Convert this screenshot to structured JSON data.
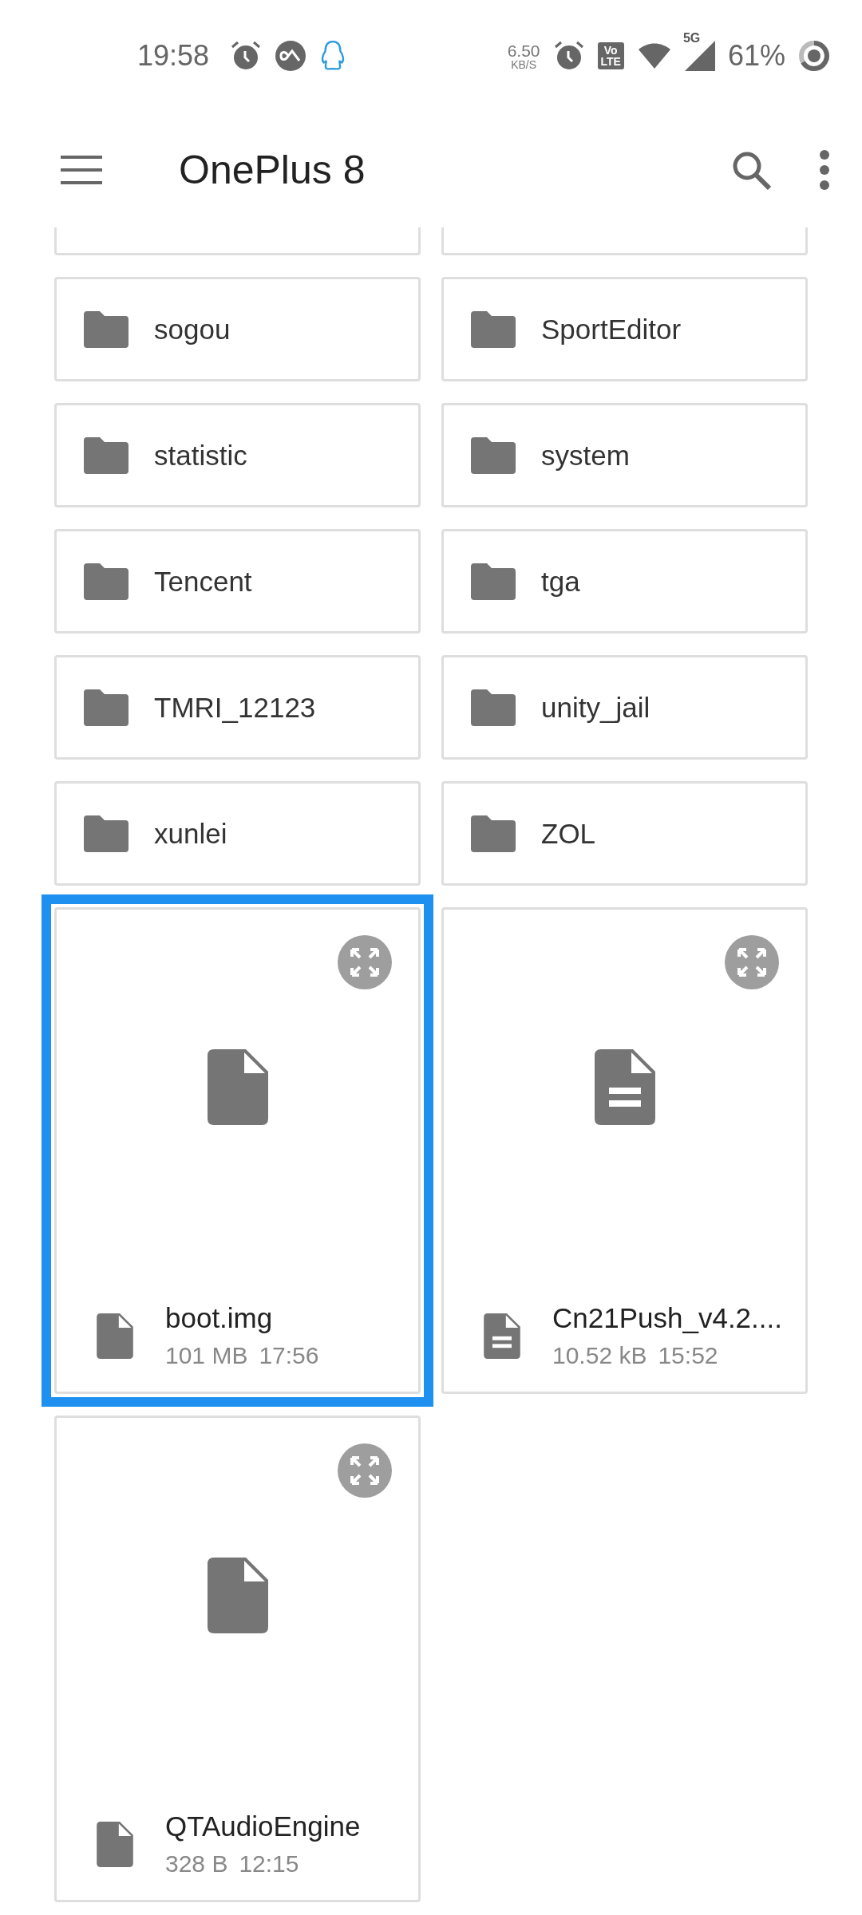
{
  "status_bar": {
    "time": "19:58",
    "speed_value": "6.50",
    "speed_unit": "KB/S",
    "volte_top": "Vo",
    "volte_bottom": "LTE",
    "network": "5G",
    "battery": "61%"
  },
  "app_bar": {
    "title": "OnePlus 8"
  },
  "items": [
    {
      "kind": "partial",
      "selected": false
    },
    {
      "kind": "partial",
      "selected": false
    },
    {
      "kind": "folder",
      "name": "sogou",
      "selected": false
    },
    {
      "kind": "folder",
      "name": "SportEditor",
      "selected": false
    },
    {
      "kind": "folder",
      "name": "statistic",
      "selected": false
    },
    {
      "kind": "folder",
      "name": "system",
      "selected": false
    },
    {
      "kind": "folder",
      "name": "Tencent",
      "selected": false
    },
    {
      "kind": "folder",
      "name": "tga",
      "selected": false
    },
    {
      "kind": "folder",
      "name": "TMRI_12123",
      "selected": false
    },
    {
      "kind": "folder",
      "name": "unity_jail",
      "selected": false
    },
    {
      "kind": "folder",
      "name": "xunlei",
      "selected": false
    },
    {
      "kind": "folder",
      "name": "ZOL",
      "selected": false
    },
    {
      "kind": "file",
      "icon": {
        "kind": "blank"
      },
      "name": "boot.img",
      "size": "101 MB",
      "time": "17:56",
      "selected": true
    },
    {
      "kind": "file",
      "icon": {
        "kind": "text"
      },
      "name": "Cn21Push_v4.2....",
      "size": "10.52 kB",
      "time": "15:52",
      "selected": false
    },
    {
      "kind": "file",
      "icon": {
        "kind": "blank"
      },
      "name": "QTAudioEngine",
      "size": "328 B",
      "time": "12:15",
      "selected": false
    }
  ]
}
